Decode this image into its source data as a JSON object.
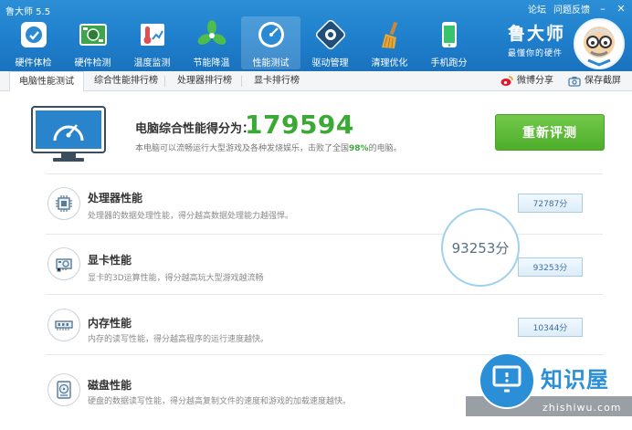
{
  "app": {
    "title": "鲁大师 5.5"
  },
  "window_links": {
    "forum": "论坛",
    "feedback": "问题反馈",
    "minimize": "–",
    "close": "✕"
  },
  "nav": [
    {
      "label": "硬件体检",
      "icon": "hardware-check-icon"
    },
    {
      "label": "硬件检测",
      "icon": "circuit-board-icon"
    },
    {
      "label": "温度监测",
      "icon": "thermometer-icon"
    },
    {
      "label": "节能降温",
      "icon": "fan-icon"
    },
    {
      "label": "性能测试",
      "icon": "gauge-icon",
      "active": true
    },
    {
      "label": "驱动管理",
      "icon": "gear-driver-icon"
    },
    {
      "label": "清理优化",
      "icon": "broom-icon"
    },
    {
      "label": "手机跑分",
      "icon": "phone-icon"
    }
  ],
  "brand": {
    "name": "鲁大师",
    "slogan": "最懂你的硬件"
  },
  "tabs": [
    {
      "label": "电脑性能测试",
      "active": true
    },
    {
      "label": "综合性能排行榜"
    },
    {
      "label": "处理器排行榜"
    },
    {
      "label": "显卡排行榜"
    }
  ],
  "toolbar": {
    "share": "微博分享",
    "save": "保存截屏"
  },
  "score": {
    "label": "电脑综合性能得分为：",
    "value": "179594",
    "desc_prefix": "本电脑可以流畅运行大型游戏及各种发烧娱乐，击败了全国",
    "percent": "98%",
    "desc_suffix": "的电脑。",
    "retest_label": "重新评测"
  },
  "rows": [
    {
      "title": "处理器性能",
      "desc": "处理器的数据处理性能，得分越高数据处理能力越强悍。",
      "score": "72787分",
      "icon": "cpu-chip-icon"
    },
    {
      "title": "显卡性能",
      "desc": "显卡的3D运算性能，得分越高玩大型游戏越流畅",
      "score": "93253分",
      "icon": "graphics-card-icon"
    },
    {
      "title": "内存性能",
      "desc": "内存的读写性能，得分越高程序的运行速度越快。",
      "score": "10344分",
      "icon": "memory-stick-icon"
    },
    {
      "title": "磁盘性能",
      "desc": "硬盘的数据读写性能，得分越高复制文件的速度和游戏的加载速度越快。",
      "score": "",
      "icon": "hard-disk-icon"
    }
  ],
  "bubble": {
    "text": "93253分"
  },
  "watermark": {
    "title": "知识屋",
    "url": "zhishiwu.com"
  },
  "colors": {
    "header_blue": "#1f7fcc",
    "score_green": "#3aaa35",
    "button_green": "#5cb934",
    "badge_blue": "#dcecf8"
  }
}
